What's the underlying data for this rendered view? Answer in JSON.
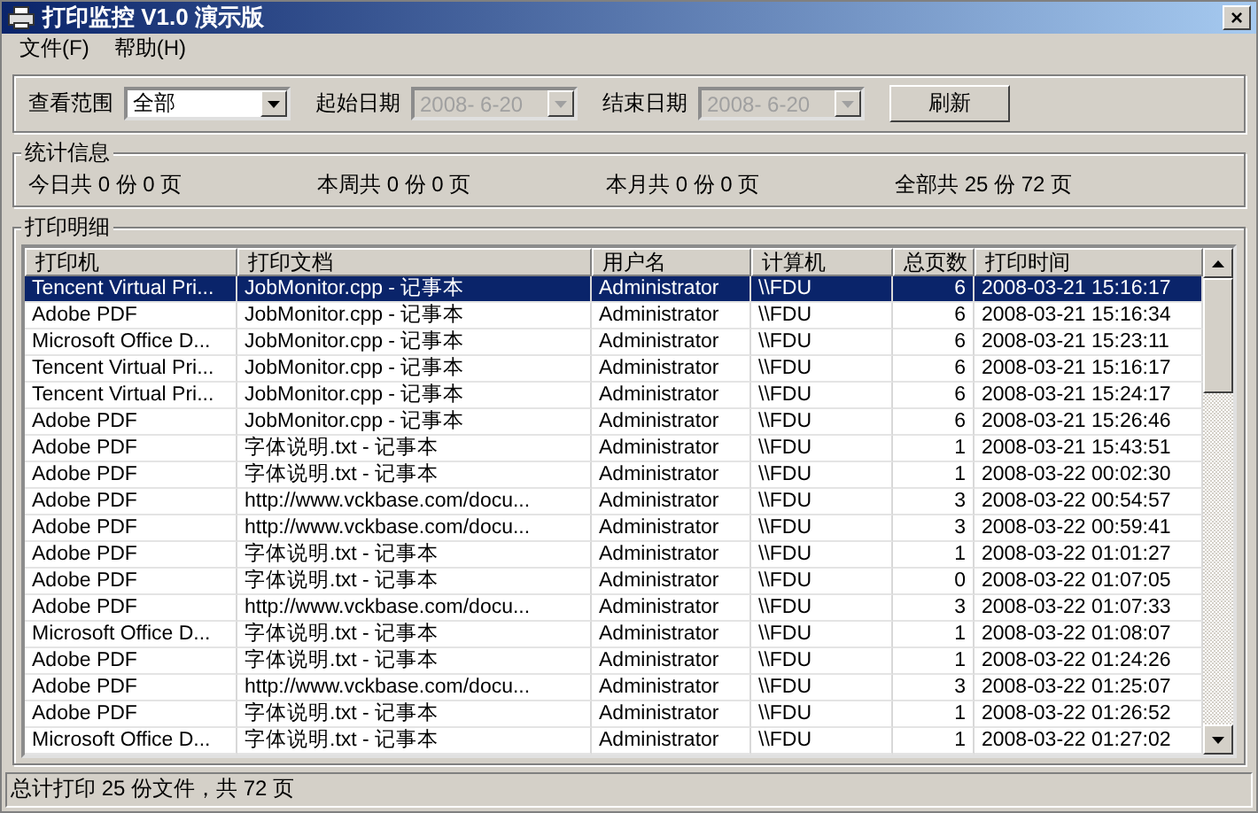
{
  "window": {
    "title": "打印监控 V1.0 演示版",
    "close": "×"
  },
  "menu": [
    "文件(F)",
    "帮助(H)"
  ],
  "filter": {
    "range_label": "查看范围",
    "range_value": "全部",
    "start_label": "起始日期",
    "start_value": "2008-  6-20",
    "start_disabled": true,
    "end_label": "结束日期",
    "end_value": "2008-  6-20",
    "end_disabled": true,
    "refresh": "刷新"
  },
  "stats": {
    "title": "统计信息",
    "items": [
      "今日共 0 份 0 页",
      "本周共 0 份 0 页",
      "本月共 0 份 0 页",
      "全部共 25 份 72 页"
    ]
  },
  "list": {
    "title": "打印明细",
    "columns": [
      "打印机",
      "打印文档",
      "用户名",
      "计算机",
      "总页数",
      "打印时间"
    ],
    "rows": [
      {
        "cells": [
          "Tencent Virtual Pri...",
          "JobMonitor.cpp - 记事本",
          "Administrator",
          "\\\\FDU",
          "6",
          "2008-03-21 15:16:17"
        ],
        "selected": true
      },
      {
        "cells": [
          "Adobe PDF",
          "JobMonitor.cpp - 记事本",
          "Administrator",
          "\\\\FDU",
          "6",
          "2008-03-21 15:16:34"
        ],
        "selected": false
      },
      {
        "cells": [
          "Microsoft Office D...",
          "JobMonitor.cpp - 记事本",
          "Administrator",
          "\\\\FDU",
          "6",
          "2008-03-21 15:23:11"
        ],
        "selected": false
      },
      {
        "cells": [
          "Tencent Virtual Pri...",
          "JobMonitor.cpp - 记事本",
          "Administrator",
          "\\\\FDU",
          "6",
          "2008-03-21 15:16:17"
        ],
        "selected": false
      },
      {
        "cells": [
          "Tencent Virtual Pri...",
          "JobMonitor.cpp - 记事本",
          "Administrator",
          "\\\\FDU",
          "6",
          "2008-03-21 15:24:17"
        ],
        "selected": false
      },
      {
        "cells": [
          "Adobe PDF",
          "JobMonitor.cpp - 记事本",
          "Administrator",
          "\\\\FDU",
          "6",
          "2008-03-21 15:26:46"
        ],
        "selected": false
      },
      {
        "cells": [
          "Adobe PDF",
          "字体说明.txt - 记事本",
          "Administrator",
          "\\\\FDU",
          "1",
          "2008-03-21 15:43:51"
        ],
        "selected": false
      },
      {
        "cells": [
          "Adobe PDF",
          "字体说明.txt - 记事本",
          "Administrator",
          "\\\\FDU",
          "1",
          "2008-03-22 00:02:30"
        ],
        "selected": false
      },
      {
        "cells": [
          "Adobe PDF",
          "http://www.vckbase.com/docu...",
          "Administrator",
          "\\\\FDU",
          "3",
          "2008-03-22 00:54:57"
        ],
        "selected": false
      },
      {
        "cells": [
          "Adobe PDF",
          "http://www.vckbase.com/docu...",
          "Administrator",
          "\\\\FDU",
          "3",
          "2008-03-22 00:59:41"
        ],
        "selected": false
      },
      {
        "cells": [
          "Adobe PDF",
          "字体说明.txt - 记事本",
          "Administrator",
          "\\\\FDU",
          "1",
          "2008-03-22 01:01:27"
        ],
        "selected": false
      },
      {
        "cells": [
          "Adobe PDF",
          "字体说明.txt - 记事本",
          "Administrator",
          "\\\\FDU",
          "0",
          "2008-03-22 01:07:05"
        ],
        "selected": false
      },
      {
        "cells": [
          "Adobe PDF",
          "http://www.vckbase.com/docu...",
          "Administrator",
          "\\\\FDU",
          "3",
          "2008-03-22 01:07:33"
        ],
        "selected": false
      },
      {
        "cells": [
          "Microsoft Office D...",
          "字体说明.txt - 记事本",
          "Administrator",
          "\\\\FDU",
          "1",
          "2008-03-22 01:08:07"
        ],
        "selected": false
      },
      {
        "cells": [
          "Adobe PDF",
          "字体说明.txt - 记事本",
          "Administrator",
          "\\\\FDU",
          "1",
          "2008-03-22 01:24:26"
        ],
        "selected": false
      },
      {
        "cells": [
          "Adobe PDF",
          "http://www.vckbase.com/docu...",
          "Administrator",
          "\\\\FDU",
          "3",
          "2008-03-22 01:25:07"
        ],
        "selected": false
      },
      {
        "cells": [
          "Adobe PDF",
          "字体说明.txt - 记事本",
          "Administrator",
          "\\\\FDU",
          "1",
          "2008-03-22 01:26:52"
        ],
        "selected": false
      },
      {
        "cells": [
          "Microsoft Office D...",
          "字体说明.txt - 记事本",
          "Administrator",
          "\\\\FDU",
          "1",
          "2008-03-22 01:27:02"
        ],
        "selected": false
      }
    ]
  },
  "status_bar": "总计打印 25 份文件，共 72 页"
}
